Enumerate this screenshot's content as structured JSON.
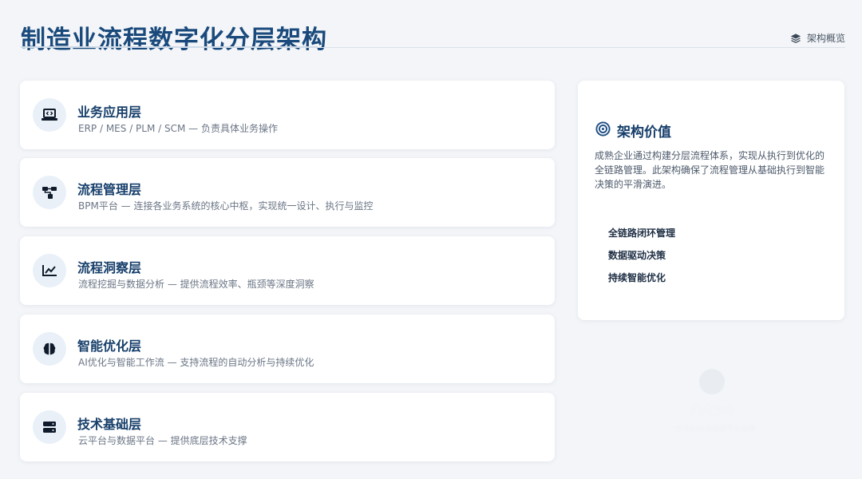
{
  "header": {
    "title": "制造业流程数字化分层架构",
    "nav_label": "架构概览",
    "nav_icon": "layers-icon"
  },
  "layers": [
    {
      "name": "业务应用层",
      "desc": "ERP / MES / PLM / SCM — 负责具体业务操作",
      "icon": "laptop-code-icon"
    },
    {
      "name": "流程管理层",
      "desc": "BPM平台 — 连接各业务系统的核心中枢，实现统一设计、执行与监控",
      "icon": "sitemap-icon"
    },
    {
      "name": "流程洞察层",
      "desc": "流程挖掘与数据分析 — 提供流程效率、瓶颈等深度洞察",
      "icon": "chart-line-icon"
    },
    {
      "name": "智能优化层",
      "desc": "AI优化与智能工作流 — 支持流程的自动分析与持续优化",
      "icon": "brain-icon"
    },
    {
      "name": "技术基础层",
      "desc": "云平台与数据平台 — 提供底层技术支撑",
      "icon": "server-icon"
    }
  ],
  "value_panel": {
    "title": "架构价值",
    "icon": "target-icon",
    "desc": "成熟企业通过构建分层流程体系，实现从执行到优化的全链路管理。此架构确保了流程管理从基础执行到智能决策的平滑演进。",
    "points": [
      "全链路闭环管理",
      "数据驱动决策",
      "持续智能优化"
    ]
  },
  "ghost": {
    "title": "演进方向",
    "subtitle": "• 支持BPM与数据平台协同"
  },
  "colors": {
    "title": "#1a4a7c",
    "heading": "#173f6b",
    "icon_bg": "#e9f0f8",
    "accent": "#1e4f83",
    "background": "#f3f5f8"
  }
}
